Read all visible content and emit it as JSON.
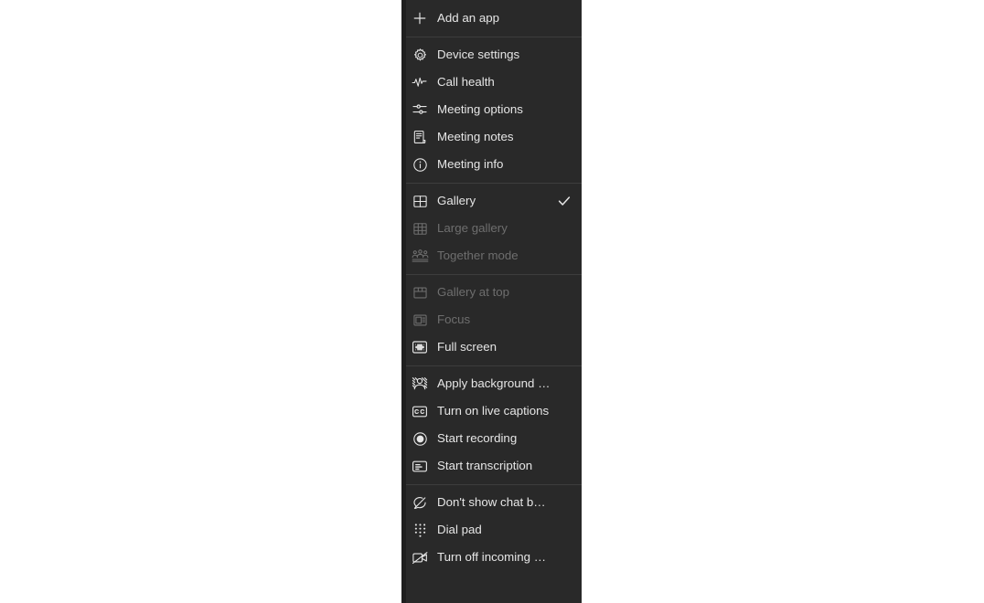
{
  "menu": {
    "name": "meeting-more-actions-menu",
    "background_color": "#292929",
    "text_color": "#e6e6e6",
    "disabled_text_color": "#6e6e6e",
    "divider_color": "#3d3d3d",
    "groups": [
      {
        "id": "apps",
        "items": [
          {
            "label": "Add an app",
            "icon": "plus-icon",
            "disabled": false,
            "checked": false
          }
        ]
      },
      {
        "id": "meeting-tools",
        "items": [
          {
            "label": "Device settings",
            "icon": "gear-icon",
            "disabled": false,
            "checked": false
          },
          {
            "label": "Call health",
            "icon": "pulse-icon",
            "disabled": false,
            "checked": false
          },
          {
            "label": "Meeting options",
            "icon": "sliders-icon",
            "disabled": false,
            "checked": false
          },
          {
            "label": "Meeting notes",
            "icon": "notes-icon",
            "disabled": false,
            "checked": false
          },
          {
            "label": "Meeting info",
            "icon": "info-circle-icon",
            "disabled": false,
            "checked": false
          }
        ]
      },
      {
        "id": "layout-modes",
        "items": [
          {
            "label": "Gallery",
            "icon": "grid-2x2-icon",
            "disabled": false,
            "checked": true
          },
          {
            "label": "Large gallery",
            "icon": "grid-3x3-icon",
            "disabled": true,
            "checked": false
          },
          {
            "label": "Together mode",
            "icon": "people-together-icon",
            "disabled": true,
            "checked": false
          }
        ]
      },
      {
        "id": "layout-placement",
        "items": [
          {
            "label": "Gallery at top",
            "icon": "gallery-at-top-icon",
            "disabled": true,
            "checked": false
          },
          {
            "label": "Focus",
            "icon": "focus-icon",
            "disabled": true,
            "checked": false
          },
          {
            "label": "Full screen",
            "icon": "full-screen-icon",
            "disabled": false,
            "checked": false
          }
        ]
      },
      {
        "id": "media-features",
        "items": [
          {
            "label": "Apply background effe...",
            "icon": "background-effects-icon",
            "disabled": false,
            "checked": false
          },
          {
            "label": "Turn on live captions",
            "icon": "closed-captions-icon",
            "disabled": false,
            "checked": false
          },
          {
            "label": "Start recording",
            "icon": "record-icon",
            "disabled": false,
            "checked": false
          },
          {
            "label": "Start transcription",
            "icon": "transcription-icon",
            "disabled": false,
            "checked": false
          }
        ]
      },
      {
        "id": "chat-and-video",
        "items": [
          {
            "label": "Don't show chat bubbles",
            "icon": "chat-bubble-off-icon",
            "disabled": false,
            "checked": false
          },
          {
            "label": "Dial pad",
            "icon": "dial-pad-icon",
            "disabled": false,
            "checked": false
          },
          {
            "label": "Turn off incoming video",
            "icon": "video-off-icon",
            "disabled": false,
            "checked": false
          }
        ]
      }
    ]
  }
}
